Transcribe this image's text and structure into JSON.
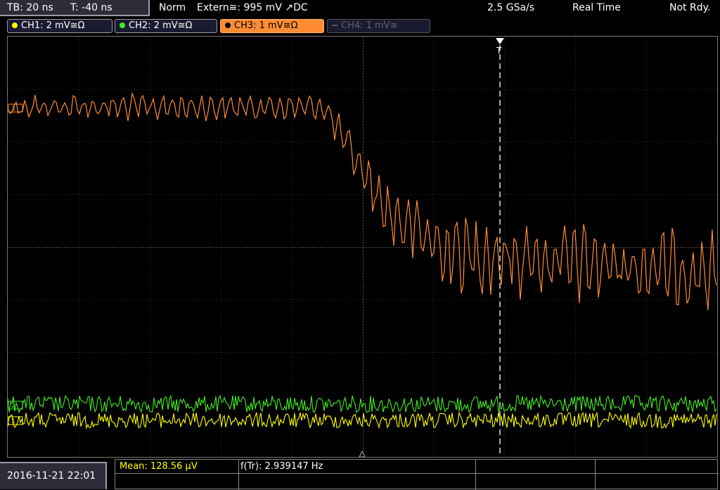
{
  "header": {
    "tb": "TB: 20 ns",
    "t": "T: -40 ns",
    "mode": "Norm",
    "trigger": "Extern≅: 995 mV ↗DC",
    "sample_rate": "2.5 GSa/s",
    "acq_mode": "Real Time",
    "state": "Not Rdy."
  },
  "channels": [
    {
      "label": "CH1: 2 mV≅Ω",
      "color": "#ffff00"
    },
    {
      "label": "CH2: 2 mV≅Ω",
      "color": "#44ee22"
    },
    {
      "label": "CH3: 1 mV≅Ω",
      "color": "#ff8c33"
    },
    {
      "label": "CH4: 1 mV≅",
      "color": "#666666"
    }
  ],
  "markers": {
    "ch3": "3",
    "ch2": "2",
    "ch1": "1",
    "trigger": "T"
  },
  "footer": {
    "datetime": "2016-11-21 22:01",
    "mean": "Mean: 128.56 µV",
    "freq": "f(Tr): 2.939147 Hz"
  }
}
